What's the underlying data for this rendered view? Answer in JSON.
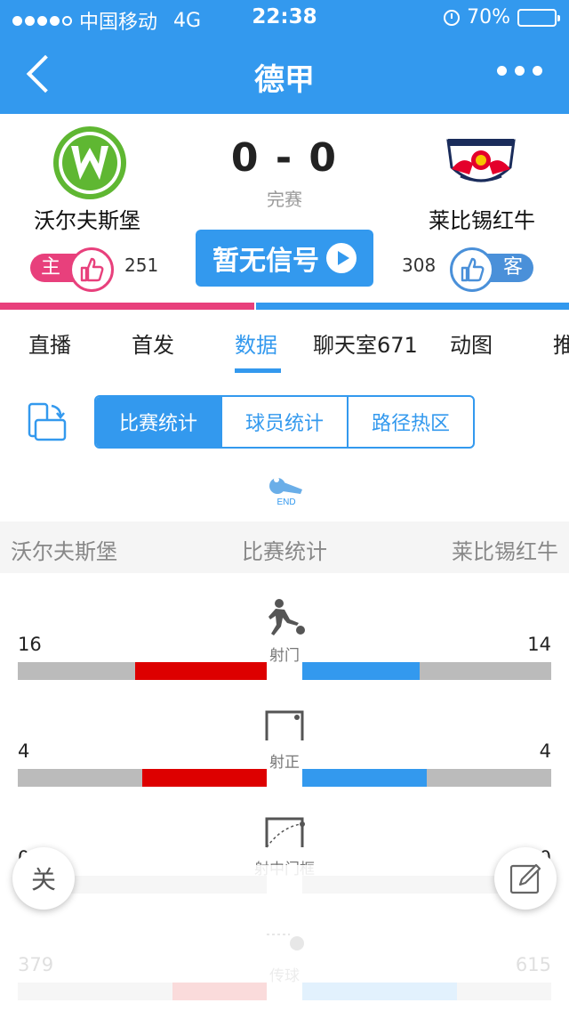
{
  "status": {
    "carrier": "中国移动",
    "network": "4G",
    "time": "22:38",
    "battery": "70%",
    "battery_fraction": 0.7
  },
  "header": {
    "title": "德甲"
  },
  "match": {
    "home": {
      "name": "沃尔夫斯堡",
      "likes": "251",
      "badge": "主"
    },
    "away": {
      "name": "莱比锡红牛",
      "likes": "308",
      "badge": "客"
    },
    "score": "0 - 0",
    "state": "完赛",
    "signal_label": "暂无信号"
  },
  "tabs": [
    "直播",
    "首发",
    "数据",
    "聊天室671",
    "动图",
    "推"
  ],
  "segments": [
    "比赛统计",
    "球员统计",
    "路径热区"
  ],
  "end_label": "END",
  "stat_header": {
    "home": "沃尔夫斯堡",
    "title": "比赛统计",
    "away": "莱比锡红牛"
  },
  "stats": [
    {
      "label": "射门",
      "home": "16",
      "away": "14",
      "home_frac": 0.53,
      "away_frac": 0.47
    },
    {
      "label": "射正",
      "home": "4",
      "away": "4",
      "home_frac": 0.5,
      "away_frac": 0.5
    },
    {
      "label": "射中门框",
      "home": "0",
      "away": "0",
      "home_frac": 0,
      "away_frac": 0
    },
    {
      "label": "传球",
      "home": "379",
      "away": "615",
      "home_frac": 0.38,
      "away_frac": 0.62
    }
  ],
  "fab": {
    "close_label": "关"
  },
  "colors": {
    "primary": "#3399ee",
    "home": "#e8407c",
    "home_bar": "#dd0000",
    "away": "#3399ee"
  }
}
